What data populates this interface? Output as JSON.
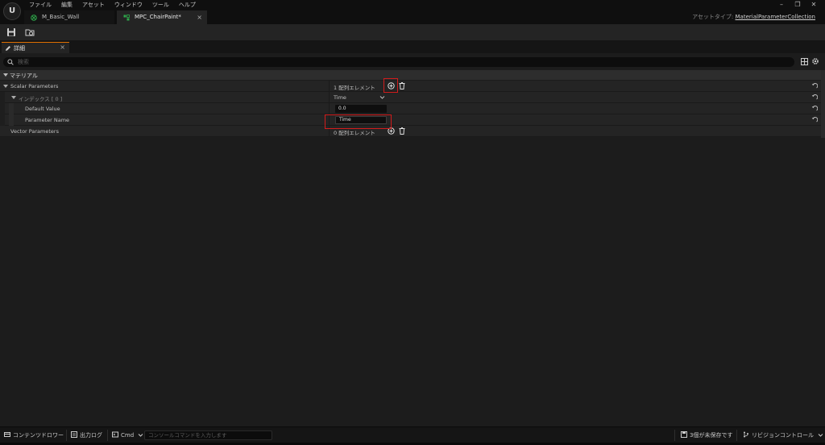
{
  "menu": [
    "ファイル",
    "編集",
    "アセット",
    "ウィンドウ",
    "ツール",
    "ヘルプ"
  ],
  "logo_text": "U",
  "tabs": [
    {
      "label": "M_Basic_Wall",
      "close": ""
    },
    {
      "label": "MPC_ChairPaint*",
      "close": "×"
    }
  ],
  "window_controls": {
    "minimize": "–",
    "restore": "❐",
    "close": "✕"
  },
  "asset_type": {
    "label": "アセットタイプ:",
    "value": "MaterialParameterCollection"
  },
  "details_tab": {
    "label": "詳細",
    "close": "×"
  },
  "search": {
    "placeholder": "検索"
  },
  "category": {
    "label": "マテリアル"
  },
  "rows": {
    "scalar": {
      "label": "Scalar Parameters",
      "value": "1 配列エレメント"
    },
    "index": {
      "label": "インデックス [ 0 ]",
      "value": "Time"
    },
    "default_value": {
      "label": "Default Value",
      "value": "0.0"
    },
    "param_name": {
      "label": "Parameter Name",
      "value": "Time"
    },
    "vector": {
      "label": "Vector Parameters",
      "value": "0 配列エレメント"
    }
  },
  "statusbar": {
    "content_drawer": "コンテンツドロワー",
    "output_log": "出力ログ",
    "cmd": "Cmd",
    "console_placeholder": "コンソールコマンドを入力します",
    "unsaved": "3個が未保存です",
    "revision": "リビジョンコントロール"
  },
  "colors": {
    "accent": "#e07000",
    "highlight": "#d21c1c",
    "tab_icon_green": "#2ea84a"
  }
}
